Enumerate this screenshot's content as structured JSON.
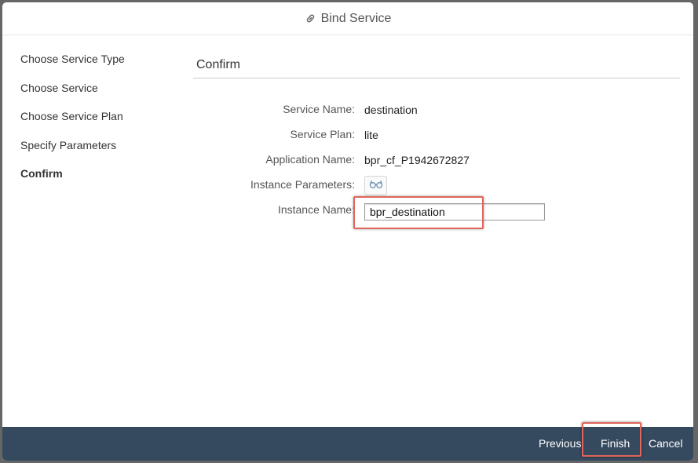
{
  "dialog": {
    "title": "Bind Service",
    "title_icon": "link-icon"
  },
  "steps": [
    {
      "label": "Choose Service Type",
      "active": false
    },
    {
      "label": "Choose Service",
      "active": false
    },
    {
      "label": "Choose Service Plan",
      "active": false
    },
    {
      "label": "Specify Parameters",
      "active": false
    },
    {
      "label": "Confirm",
      "active": true
    }
  ],
  "confirm": {
    "title": "Confirm",
    "service_name_label": "Service Name:",
    "service_name_value": "destination",
    "service_plan_label": "Service Plan:",
    "service_plan_value": "lite",
    "application_name_label": "Application Name:",
    "application_name_value": "bpr_cf_P1942672827",
    "instance_parameters_label": "Instance Parameters:",
    "instance_parameters_icon": "glasses-icon",
    "instance_name_label": "Instance Name:",
    "instance_name_value": "bpr_destination"
  },
  "footer": {
    "previous_label": "Previous",
    "finish_label": "Finish",
    "cancel_label": "Cancel"
  },
  "colors": {
    "footer_bg": "#354a5f",
    "highlight": "#e0655a",
    "backdrop": "#666666"
  }
}
